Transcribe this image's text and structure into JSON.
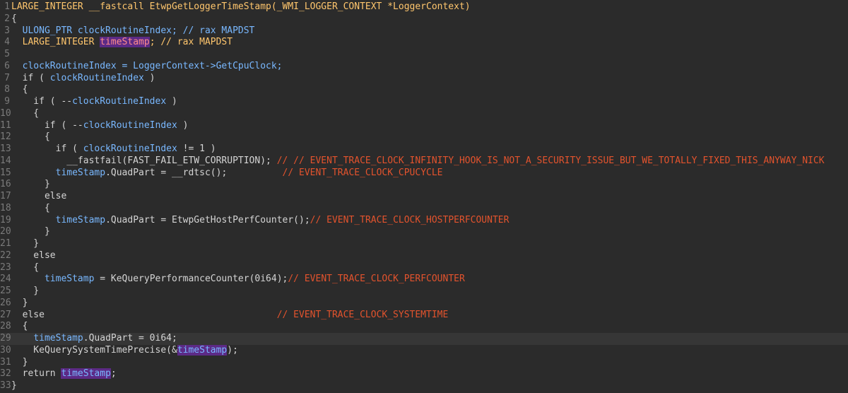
{
  "lines": [
    {
      "n": "1",
      "segments": [
        {
          "t": "LARGE_INTEGER __fastcall EtwpGetLoggerTimeStamp(_WMI_LOGGER_CONTEXT *LoggerContext)",
          "c": "type"
        }
      ]
    },
    {
      "n": "2",
      "segments": [
        {
          "t": "{",
          "c": "plain"
        }
      ]
    },
    {
      "n": "3",
      "segments": [
        {
          "t": "  ULONG_PTR clockRoutineIndex; ",
          "c": "var"
        },
        {
          "t": "// rax MAPDST",
          "c": "var"
        }
      ]
    },
    {
      "n": "4",
      "segments": [
        {
          "t": "  LARGE_INTEGER ",
          "c": "type"
        },
        {
          "t": "timeStamp",
          "c": "hl-ts"
        },
        {
          "t": "; // rax MAPDST",
          "c": "type"
        }
      ]
    },
    {
      "n": "5",
      "segments": []
    },
    {
      "n": "6",
      "segments": [
        {
          "t": "  clockRoutineIndex = LoggerContext->GetCpuClock;",
          "c": "var"
        }
      ]
    },
    {
      "n": "7",
      "segments": [
        {
          "t": "  if ( ",
          "c": "plain"
        },
        {
          "t": "clockRoutineIndex",
          "c": "var"
        },
        {
          "t": " )",
          "c": "plain"
        }
      ]
    },
    {
      "n": "8",
      "segments": [
        {
          "t": "  {",
          "c": "plain"
        }
      ]
    },
    {
      "n": "9",
      "segments": [
        {
          "t": "    if ( --",
          "c": "plain"
        },
        {
          "t": "clockRoutineIndex",
          "c": "var"
        },
        {
          "t": " )",
          "c": "plain"
        }
      ]
    },
    {
      "n": "10",
      "segments": [
        {
          "t": "    {",
          "c": "plain"
        }
      ]
    },
    {
      "n": "11",
      "segments": [
        {
          "t": "      if ( --",
          "c": "plain"
        },
        {
          "t": "clockRoutineIndex",
          "c": "var"
        },
        {
          "t": " )",
          "c": "plain"
        }
      ]
    },
    {
      "n": "12",
      "segments": [
        {
          "t": "      {",
          "c": "plain"
        }
      ]
    },
    {
      "n": "13",
      "segments": [
        {
          "t": "        if ( ",
          "c": "plain"
        },
        {
          "t": "clockRoutineIndex",
          "c": "var"
        },
        {
          "t": " != 1 )",
          "c": "plain"
        }
      ]
    },
    {
      "n": "14",
      "segments": [
        {
          "t": "          __fastfail(FAST_FAIL_ETW_CORRUPTION); ",
          "c": "plain"
        },
        {
          "t": "// // EVENT_TRACE_CLOCK_INFINITY_HOOK_IS_NOT_A_SECURITY_ISSUE_BUT_WE_TOTALLY_FIXED_THIS_ANYWAY_NICK",
          "c": "comment"
        }
      ]
    },
    {
      "n": "15",
      "segments": [
        {
          "t": "        ",
          "c": "plain"
        },
        {
          "t": "timeStamp",
          "c": "var"
        },
        {
          "t": ".QuadPart = __rdtsc();          ",
          "c": "plain"
        },
        {
          "t": "// EVENT_TRACE_CLOCK_CPUCYCLE",
          "c": "comment"
        }
      ]
    },
    {
      "n": "16",
      "segments": [
        {
          "t": "      }",
          "c": "plain"
        }
      ]
    },
    {
      "n": "17",
      "segments": [
        {
          "t": "      else",
          "c": "plain"
        }
      ]
    },
    {
      "n": "18",
      "segments": [
        {
          "t": "      {",
          "c": "plain"
        }
      ]
    },
    {
      "n": "19",
      "segments": [
        {
          "t": "        ",
          "c": "plain"
        },
        {
          "t": "timeStamp",
          "c": "var"
        },
        {
          "t": ".QuadPart = EtwpGetHostPerfCounter();",
          "c": "plain"
        },
        {
          "t": "// EVENT_TRACE_CLOCK_HOSTPERFCOUNTER",
          "c": "comment"
        }
      ]
    },
    {
      "n": "20",
      "segments": [
        {
          "t": "      }",
          "c": "plain"
        }
      ]
    },
    {
      "n": "21",
      "segments": [
        {
          "t": "    }",
          "c": "plain"
        }
      ]
    },
    {
      "n": "22",
      "segments": [
        {
          "t": "    else",
          "c": "plain"
        }
      ]
    },
    {
      "n": "23",
      "segments": [
        {
          "t": "    {",
          "c": "plain"
        }
      ]
    },
    {
      "n": "24",
      "segments": [
        {
          "t": "      ",
          "c": "plain"
        },
        {
          "t": "timeStamp",
          "c": "var"
        },
        {
          "t": " = KeQueryPerformanceCounter(0i64);",
          "c": "plain"
        },
        {
          "t": "// EVENT_TRACE_CLOCK_PERFCOUNTER",
          "c": "comment"
        }
      ]
    },
    {
      "n": "25",
      "segments": [
        {
          "t": "    }",
          "c": "plain"
        }
      ]
    },
    {
      "n": "26",
      "segments": [
        {
          "t": "  }",
          "c": "plain"
        }
      ]
    },
    {
      "n": "27",
      "segments": [
        {
          "t": "  else                                          ",
          "c": "plain"
        },
        {
          "t": "// EVENT_TRACE_CLOCK_SYSTEMTIME",
          "c": "comment"
        }
      ]
    },
    {
      "n": "28",
      "segments": [
        {
          "t": "  {",
          "c": "plain"
        }
      ]
    },
    {
      "n": "29",
      "highlight": true,
      "segments": [
        {
          "t": "    ",
          "c": "plain"
        },
        {
          "t": "timeStamp",
          "c": "var"
        },
        {
          "t": ".QuadPart = 0i64;",
          "c": "plain"
        }
      ]
    },
    {
      "n": "30",
      "segments": [
        {
          "t": "    KeQuerySystemTimePrecise(&",
          "c": "plain"
        },
        {
          "t": "timeStamp",
          "c": "hl"
        },
        {
          "t": ");",
          "c": "plain"
        }
      ]
    },
    {
      "n": "31",
      "segments": [
        {
          "t": "  }",
          "c": "plain"
        }
      ]
    },
    {
      "n": "32",
      "segments": [
        {
          "t": "  return ",
          "c": "plain"
        },
        {
          "t": "timeStamp",
          "c": "hl"
        },
        {
          "t": ";",
          "c": "plain"
        }
      ]
    },
    {
      "n": "33",
      "segments": [
        {
          "t": "}",
          "c": "plain"
        }
      ]
    }
  ]
}
